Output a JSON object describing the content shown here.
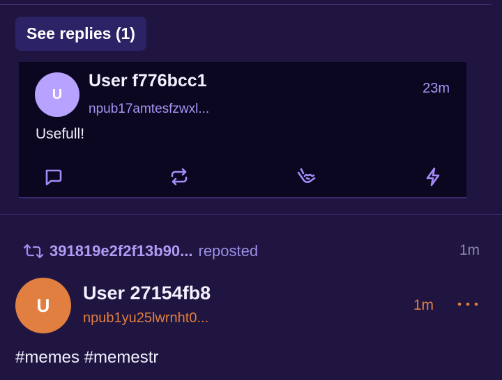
{
  "replies": {
    "see_replies_label": "See replies (1)"
  },
  "reply": {
    "avatar_initial": "U",
    "username": "User f776bcc1",
    "npub": "npub17amtesfzwxl...",
    "time": "23m",
    "content": "Usefull!",
    "actions": [
      "comment-icon",
      "repost-icon",
      "shaka-reaction-icon",
      "zap-icon"
    ]
  },
  "repost": {
    "icon": "repost-icon",
    "reposter": "391819e2f2f13b90...",
    "label": "reposted",
    "time": "1m"
  },
  "post": {
    "avatar_initial": "U",
    "username": "User 27154fb8",
    "npub": "npub1yu25lwrnht0...",
    "time": "1m",
    "content": "#memes #memestr",
    "more_icon": "more-horizontal-icon"
  },
  "colors": {
    "background": "#1f1540",
    "card_background": "#0b0720",
    "accent_purple": "#a48cf8",
    "accent_orange": "#e07f3f",
    "button_background": "#2c2266"
  }
}
